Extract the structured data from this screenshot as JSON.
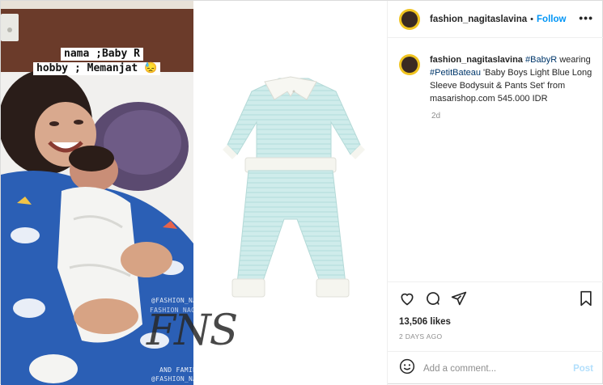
{
  "media": {
    "caption_line1": "nama ;Baby R",
    "caption_line2": "hobby ; Memanjat 😓",
    "watermark_top": "@FASHION_NAGITASLAVINA",
    "watermark_middle": "FASHION NAGITA SLAVINA",
    "watermark_logo": "FNS",
    "watermark_sub": "AND FAMILY",
    "watermark_bottom": "@FASHION_NAGITASLAVINA"
  },
  "header": {
    "username": "fashion_nagitaslavina",
    "separator": "•",
    "follow_label": "Follow",
    "more_label": "•••"
  },
  "caption": {
    "username": "fashion_nagitaslavina",
    "tag1": "#BabyR",
    "text1": " wearing ",
    "tag2": "#PetitBateau",
    "text2": " 'Baby Boys Light Blue Long Sleeve Bodysuit & Pants Set' from masarishop.com 545.000 IDR",
    "age": "2d"
  },
  "actions": {
    "like_icon": "heart-icon",
    "comment_icon": "comment-icon",
    "share_icon": "share-icon",
    "save_icon": "bookmark-icon"
  },
  "likes": "13,506 likes",
  "timestamp": "2 DAYS AGO",
  "add_comment": {
    "emoji_icon": "smiley-icon",
    "placeholder": "Add a comment...",
    "post_label": "Post"
  },
  "colors": {
    "accent": "#0095f6",
    "post_disabled": "#b2dffc",
    "tag": "#00376b",
    "muted": "#8e8e8e"
  }
}
